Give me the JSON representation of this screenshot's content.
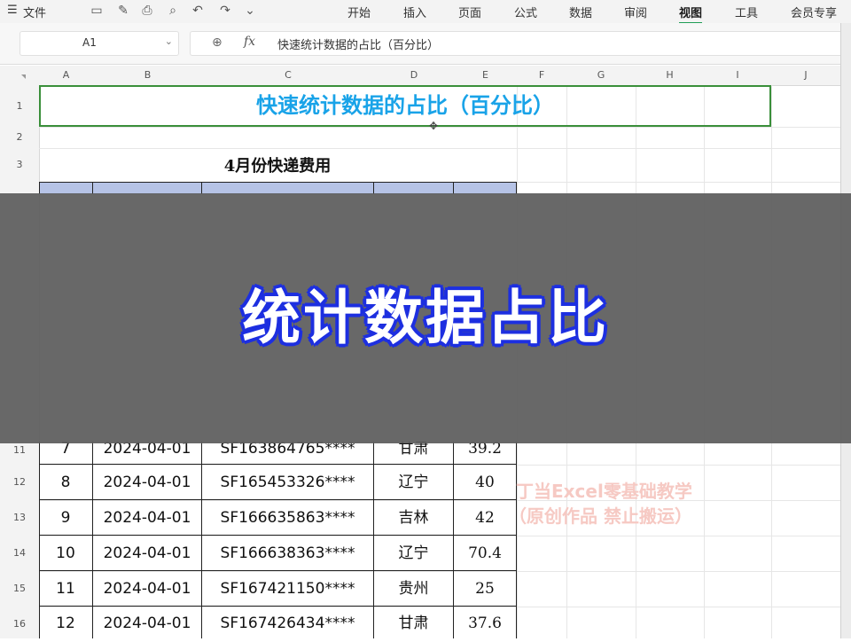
{
  "menubar": {
    "menu_icon": "☰",
    "file": "文件",
    "quick_icons": [
      "save-icon",
      "brush-icon",
      "print-icon",
      "print-preview-icon",
      "undo-icon",
      "redo-icon",
      "more-icon"
    ],
    "tabs": [
      "开始",
      "插入",
      "页面",
      "公式",
      "数据",
      "审阅",
      "视图",
      "工具",
      "会员专享"
    ],
    "active_tab": "视图"
  },
  "formula_bar": {
    "cell_ref": "A1",
    "fx_label": "fx",
    "content": "快速统计数据的占比（百分比）"
  },
  "columns": [
    "A",
    "B",
    "C",
    "D",
    "E",
    "F",
    "G",
    "H",
    "I",
    "J"
  ],
  "rows_top": [
    "1",
    "2",
    "3"
  ],
  "rows_bottom": [
    "11",
    "12",
    "13",
    "14",
    "15",
    "16"
  ],
  "sheet": {
    "title": "快速统计数据的占比（百分比）",
    "subtitle": "4月份快递费用",
    "rows": [
      {
        "no": "7",
        "date": "2024-04-01",
        "tracking": "SF163864765****",
        "province": "甘肃",
        "fee": "39.2"
      },
      {
        "no": "8",
        "date": "2024-04-01",
        "tracking": "SF165453326****",
        "province": "辽宁",
        "fee": "40"
      },
      {
        "no": "9",
        "date": "2024-04-01",
        "tracking": "SF166635863****",
        "province": "吉林",
        "fee": "42"
      },
      {
        "no": "10",
        "date": "2024-04-01",
        "tracking": "SF166638363****",
        "province": "辽宁",
        "fee": "70.4"
      },
      {
        "no": "11",
        "date": "2024-04-01",
        "tracking": "SF167421150****",
        "province": "贵州",
        "fee": "25"
      },
      {
        "no": "12",
        "date": "2024-04-01",
        "tracking": "SF167426434****",
        "province": "甘肃",
        "fee": "37.6"
      }
    ]
  },
  "overlay": {
    "caption": "统计数据占比"
  },
  "watermark": {
    "line1": "丁当Excel零基础教学",
    "line2": "（原创作品  禁止搬运）"
  },
  "colors": {
    "title": "#19a3e8",
    "header_fill": "#b6c3e6",
    "selection": "#3a8f3a",
    "overlay_text_outline": "#1d2fe0",
    "watermark": "#f6c9c3"
  }
}
